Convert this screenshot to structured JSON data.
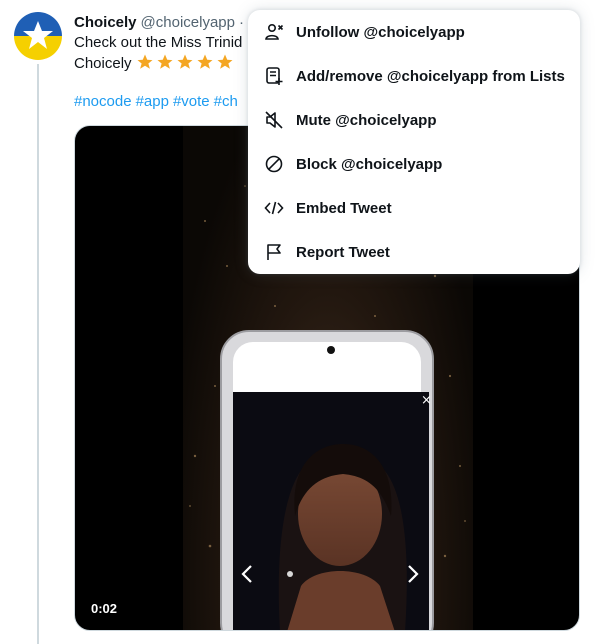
{
  "tweet": {
    "display_name": "Choicely",
    "handle": "@choicelyapp",
    "separator": "·",
    "text_line1": "Check out the Miss Trinid",
    "text_line2": "Choicely",
    "star_count": 5,
    "hashtags": [
      "#nocode",
      "#app",
      "#vote",
      "#ch"
    ],
    "video_timestamp": "0:02"
  },
  "menu": {
    "items": [
      {
        "label": "Unfollow @choicelyapp",
        "icon": "unfollow-icon"
      },
      {
        "label": "Add/remove @choicelyapp from Lists",
        "icon": "list-add-icon"
      },
      {
        "label": "Mute @choicelyapp",
        "icon": "mute-icon"
      },
      {
        "label": "Block @choicelyapp",
        "icon": "block-icon"
      },
      {
        "label": "Embed Tweet",
        "icon": "embed-icon"
      },
      {
        "label": "Report Tweet",
        "icon": "flag-icon"
      }
    ]
  },
  "colors": {
    "link": "#1d9bf0",
    "secondary_text": "#536471",
    "primary_text": "#0f1419",
    "avatar_top": "#1f5fb5",
    "avatar_bottom": "#f5d000",
    "star": "#f4a623"
  }
}
